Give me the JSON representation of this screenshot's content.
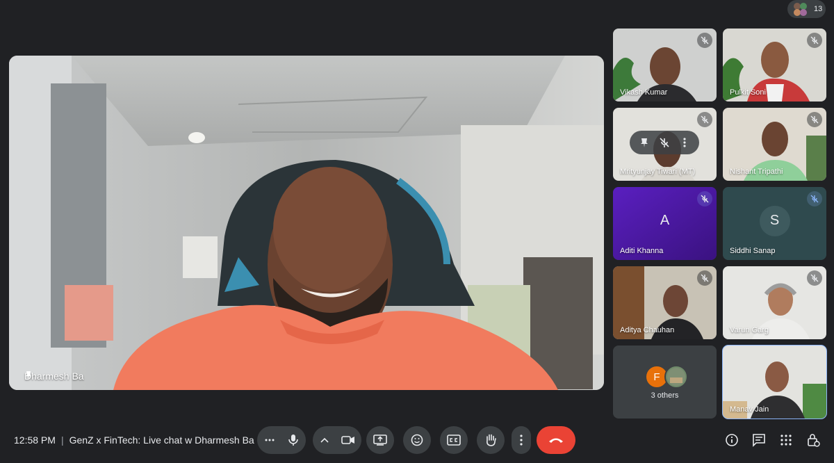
{
  "participant_count": "13",
  "main_speaker": {
    "name": "Dharmesh Ba"
  },
  "tiles": [
    {
      "name": "Vikash Kumar"
    },
    {
      "name": "Pulkit Soni"
    },
    {
      "name": "Mrityunjay Tiwari (MT)"
    },
    {
      "name": "Nishant Tripathi"
    },
    {
      "name": "Aditi Khanna",
      "initial": "A",
      "color": "#6121c2"
    },
    {
      "name": "Siddhi Sanap",
      "initial": "S",
      "color": "#34494d"
    },
    {
      "name": "Aditya Chauhan"
    },
    {
      "name": "Varun Garg"
    },
    {
      "name": "Manav Jain"
    }
  ],
  "others": {
    "label": "3 others",
    "initial": "F",
    "initial_color": "#e8710a"
  },
  "bottom_bar": {
    "time": "12:58 PM",
    "separator": "|",
    "meeting_title": "GenZ x FinTech: Live chat w Dharmesh Ba"
  },
  "controls": [
    {
      "icon": "more-options-icon"
    },
    {
      "icon": "microphone-icon"
    },
    {
      "icon": "chevron-up-icon"
    },
    {
      "icon": "camera-icon"
    },
    {
      "icon": "present-screen-icon"
    },
    {
      "icon": "emoji-icon"
    },
    {
      "icon": "captions-icon"
    },
    {
      "icon": "raise-hand-icon"
    },
    {
      "icon": "more-vert-icon"
    },
    {
      "icon": "end-call-icon"
    }
  ],
  "right_icons": [
    "info-icon",
    "chat-icon",
    "activities-icon",
    "host-controls-icon"
  ],
  "colors": {
    "background": "#202124",
    "control_bg": "#3c4043",
    "end_call": "#ea4335",
    "accent": "#8ab4f8"
  }
}
